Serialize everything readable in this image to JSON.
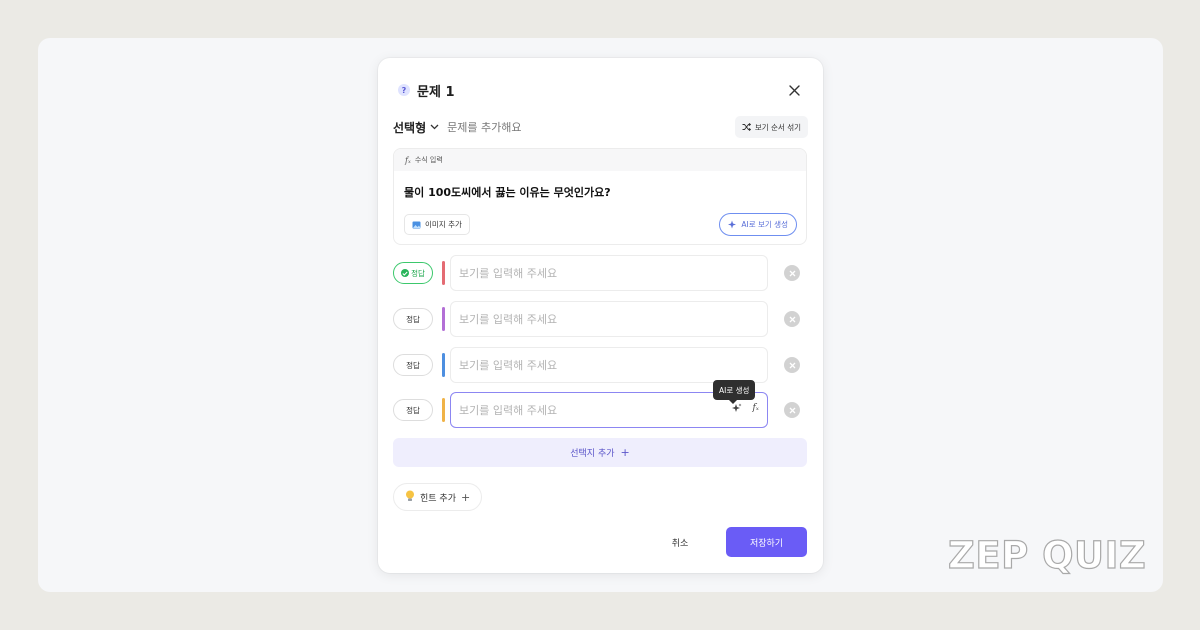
{
  "modal": {
    "title": "문제 1",
    "question_type": "선택형",
    "question_placeholder": "문제를 추가해요",
    "shuffle_label": "보기 순서 섞기",
    "formula_label": "수식 입력",
    "question_text": "물이 100도씨에서 끓는 이유는 무엇인가요?",
    "add_image_label": "이미지 추가",
    "ai_generate_label": "AI로 보기 생성",
    "options": [
      {
        "correct_label": "정답",
        "is_correct": true,
        "placeholder": "보기를 입력해 주세요",
        "color": "#e46b73"
      },
      {
        "correct_label": "정답",
        "is_correct": false,
        "placeholder": "보기를 입력해 주세요",
        "color": "#b36fd6"
      },
      {
        "correct_label": "정답",
        "is_correct": false,
        "placeholder": "보기를 입력해 주세요",
        "color": "#4d8fe0"
      },
      {
        "correct_label": "정답",
        "is_correct": false,
        "placeholder": "보기를 입력해 주세요",
        "color": "#f0b347"
      }
    ],
    "tooltip": "AI로 생성",
    "add_choice_label": "선택지 추가",
    "add_hint_label": "힌트 추가",
    "cancel_label": "취소",
    "save_label": "저장하기"
  },
  "brand": "ZEP QUIZ",
  "colors": {
    "accent": "#6a5cf6",
    "correct": "#28b45a",
    "background": "#ebeae5"
  }
}
